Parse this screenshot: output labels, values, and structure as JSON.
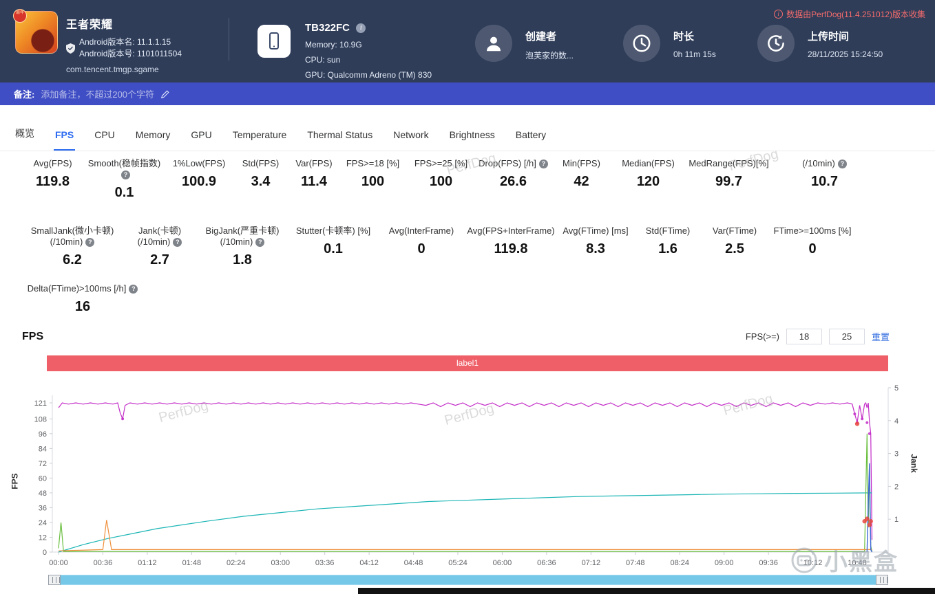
{
  "header": {
    "app": {
      "title": "王者荣耀",
      "badge": "周年",
      "version_name": "Android版本名: 11.1.1.15",
      "version_code": "Android版本号: 1101011504",
      "package": "com.tencent.tmgp.sgame"
    },
    "device": {
      "model": "TB322FC",
      "memory": "Memory: 10.9G",
      "cpu": "CPU: sun",
      "gpu": "GPU: Qualcomm Adreno (TM) 830"
    },
    "creator": {
      "label": "创建者",
      "value": "泡芙家的数..."
    },
    "duration": {
      "label": "时长",
      "value": "0h 11m 15s"
    },
    "upload_time": {
      "label": "上传时间",
      "value": "28/11/2025 15:24:50"
    },
    "version_note": "数据由PerfDog(11.4.251012)版本收集"
  },
  "note_bar": {
    "label": "备注:",
    "placeholder": "添加备注，不超过200个字符"
  },
  "tabs": [
    {
      "label": "概览",
      "active": false
    },
    {
      "label": "FPS",
      "active": true
    },
    {
      "label": "CPU",
      "active": false
    },
    {
      "label": "Memory",
      "active": false
    },
    {
      "label": "GPU",
      "active": false
    },
    {
      "label": "Temperature",
      "active": false
    },
    {
      "label": "Thermal Status",
      "active": false
    },
    {
      "label": "Network",
      "active": false
    },
    {
      "label": "Brightness",
      "active": false
    },
    {
      "label": "Battery",
      "active": false
    }
  ],
  "metrics": {
    "row1": [
      {
        "label": "Avg(FPS)",
        "value": "119.8",
        "help": false
      },
      {
        "label": "Smooth(稳帧指数)",
        "value": "0.1",
        "help": true
      },
      {
        "label": "1%Low(FPS)",
        "value": "100.9",
        "help": false
      },
      {
        "label": "Std(FPS)",
        "value": "3.4",
        "help": false
      },
      {
        "label": "Var(FPS)",
        "value": "11.4",
        "help": false
      },
      {
        "label": "FPS>=18 [%]",
        "value": "100",
        "help": false
      },
      {
        "label": "FPS>=25 [%]",
        "value": "100",
        "help": false
      },
      {
        "label": "Drop(FPS) [/h]",
        "value": "26.6",
        "help": true
      },
      {
        "label": "Min(FPS)",
        "value": "42",
        "help": false
      },
      {
        "label": "Median(FPS)",
        "value": "120",
        "help": false
      },
      {
        "label": "MedRange(FPS)[%]",
        "value": "99.7",
        "help": false
      },
      {
        "label": "(/10min)",
        "value": "10.7",
        "help": true
      }
    ],
    "row2": [
      {
        "label": "SmallJank(微小卡顿)",
        "label2": "(/10min)",
        "value": "6.2",
        "help": true
      },
      {
        "label": "Jank(卡顿)",
        "label2": "(/10min)",
        "value": "2.7",
        "help": true
      },
      {
        "label": "BigJank(严重卡顿)",
        "label2": "(/10min)",
        "value": "1.8",
        "help": true
      },
      {
        "label": "Stutter(卡顿率) [%]",
        "value": "0.1",
        "help": false
      },
      {
        "label": "Avg(InterFrame)",
        "value": "0",
        "help": false
      },
      {
        "label": "Avg(FPS+InterFrame)",
        "value": "119.8",
        "help": false
      },
      {
        "label": "Avg(FTime) [ms]",
        "value": "8.3",
        "help": false
      },
      {
        "label": "Std(FTime)",
        "value": "1.6",
        "help": false
      },
      {
        "label": "Var(FTime)",
        "value": "2.5",
        "help": false
      },
      {
        "label": "FTime>=100ms [%]",
        "value": "0",
        "help": false
      }
    ],
    "row3": [
      {
        "label": "Delta(FTime)>100ms [/h]",
        "value": "16",
        "help": true
      }
    ]
  },
  "fps_section": {
    "title": "FPS",
    "filter_label": "FPS(>=)",
    "input1": "18",
    "input2": "25",
    "reset_label": "重置",
    "banner_label": "label1",
    "banner_color": "#ef5f68"
  },
  "chart_data": {
    "type": "line",
    "title": "FPS",
    "grid": false,
    "y_left": {
      "label": "FPS",
      "ticks": [
        0,
        12,
        24,
        36,
        48,
        60,
        72,
        84,
        96,
        108,
        121
      ],
      "max": 121
    },
    "y_right": {
      "label": "Jank",
      "ticks": [
        0,
        1,
        2,
        3,
        4,
        5
      ],
      "max": 5
    },
    "x_ticks": [
      "00:00",
      "00:36",
      "01:12",
      "01:48",
      "02:24",
      "03:00",
      "03:36",
      "04:12",
      "04:48",
      "05:24",
      "06:00",
      "06:36",
      "07:12",
      "07:48",
      "08:24",
      "09:00",
      "09:36",
      "10:12",
      "10:48"
    ],
    "x_interval_seconds": 36,
    "series": [
      {
        "name": "fps",
        "color": "#c32cc8",
        "axis": "left",
        "width": 1.2,
        "points": [
          [
            0,
            117
          ],
          [
            3,
            121
          ],
          [
            8,
            120
          ],
          [
            14,
            121
          ],
          [
            20,
            120
          ],
          [
            26,
            121
          ],
          [
            32,
            120
          ],
          [
            38,
            121
          ],
          [
            44,
            120
          ],
          [
            48,
            121
          ],
          [
            50,
            113
          ],
          [
            52,
            108
          ],
          [
            54,
            119
          ],
          [
            58,
            121
          ],
          [
            64,
            120
          ],
          [
            70,
            121
          ],
          [
            76,
            120
          ],
          [
            82,
            121
          ],
          [
            88,
            120
          ],
          [
            94,
            121
          ],
          [
            100,
            120
          ],
          [
            106,
            121
          ],
          [
            112,
            120
          ],
          [
            118,
            121
          ],
          [
            124,
            120
          ],
          [
            130,
            121
          ],
          [
            136,
            120
          ],
          [
            142,
            121
          ],
          [
            148,
            120
          ],
          [
            154,
            121
          ],
          [
            160,
            120
          ],
          [
            166,
            121
          ],
          [
            172,
            120
          ],
          [
            178,
            121
          ],
          [
            184,
            120
          ],
          [
            190,
            121
          ],
          [
            196,
            120
          ],
          [
            202,
            121
          ],
          [
            208,
            120
          ],
          [
            214,
            121
          ],
          [
            220,
            120
          ],
          [
            226,
            121
          ],
          [
            232,
            120
          ],
          [
            238,
            121
          ],
          [
            244,
            120
          ],
          [
            250,
            121
          ],
          [
            256,
            120
          ],
          [
            262,
            121
          ],
          [
            268,
            120
          ],
          [
            274,
            121
          ],
          [
            280,
            120
          ],
          [
            286,
            121
          ],
          [
            292,
            120
          ],
          [
            298,
            119
          ],
          [
            304,
            121
          ],
          [
            310,
            118
          ],
          [
            316,
            121
          ],
          [
            322,
            119
          ],
          [
            328,
            121
          ],
          [
            334,
            118
          ],
          [
            340,
            121
          ],
          [
            346,
            119
          ],
          [
            352,
            121
          ],
          [
            358,
            118
          ],
          [
            364,
            121
          ],
          [
            370,
            119
          ],
          [
            376,
            121
          ],
          [
            382,
            118
          ],
          [
            388,
            121
          ],
          [
            394,
            119
          ],
          [
            400,
            121
          ],
          [
            406,
            118
          ],
          [
            412,
            121
          ],
          [
            418,
            119
          ],
          [
            424,
            121
          ],
          [
            430,
            118
          ],
          [
            436,
            121
          ],
          [
            442,
            119
          ],
          [
            448,
            121
          ],
          [
            454,
            118
          ],
          [
            460,
            121
          ],
          [
            466,
            119
          ],
          [
            472,
            121
          ],
          [
            478,
            118
          ],
          [
            484,
            121
          ],
          [
            490,
            119
          ],
          [
            496,
            121
          ],
          [
            502,
            118
          ],
          [
            508,
            121
          ],
          [
            514,
            119
          ],
          [
            520,
            121
          ],
          [
            526,
            118
          ],
          [
            532,
            121
          ],
          [
            538,
            119
          ],
          [
            544,
            121
          ],
          [
            550,
            118
          ],
          [
            556,
            121
          ],
          [
            562,
            119
          ],
          [
            568,
            121
          ],
          [
            574,
            118
          ],
          [
            580,
            121
          ],
          [
            586,
            119
          ],
          [
            592,
            121
          ],
          [
            598,
            118
          ],
          [
            604,
            121
          ],
          [
            610,
            119
          ],
          [
            616,
            121
          ],
          [
            622,
            120
          ],
          [
            628,
            121
          ],
          [
            634,
            120
          ],
          [
            640,
            121
          ],
          [
            644,
            120
          ],
          [
            646,
            112
          ],
          [
            648,
            105
          ],
          [
            650,
            119
          ],
          [
            652,
            108
          ],
          [
            654,
            120
          ],
          [
            655,
            121
          ],
          [
            656,
            117
          ],
          [
            657,
            121
          ],
          [
            658,
            105
          ],
          [
            659,
            96
          ],
          [
            660,
            10
          ]
        ]
      },
      {
        "name": "fps-dip-markers",
        "color": "#c32cc8",
        "axis": "left",
        "r": 2,
        "dots": [
          [
            52,
            108
          ],
          [
            646,
            112
          ],
          [
            648,
            105
          ],
          [
            652,
            108
          ],
          [
            656,
            105
          ],
          [
            658,
            96
          ]
        ]
      },
      {
        "name": "cumulative-curve",
        "color": "#1cb5b5",
        "axis": "left",
        "width": 1.2,
        "points": [
          [
            0,
            0
          ],
          [
            20,
            6
          ],
          [
            40,
            11
          ],
          [
            60,
            15
          ],
          [
            80,
            19
          ],
          [
            100,
            22
          ],
          [
            120,
            25
          ],
          [
            150,
            29
          ],
          [
            180,
            32
          ],
          [
            210,
            35
          ],
          [
            240,
            37
          ],
          [
            270,
            39
          ],
          [
            300,
            41
          ],
          [
            330,
            42
          ],
          [
            360,
            43
          ],
          [
            390,
            44
          ],
          [
            420,
            45
          ],
          [
            450,
            45.5
          ],
          [
            480,
            46
          ],
          [
            510,
            46.5
          ],
          [
            540,
            47
          ],
          [
            570,
            47.3
          ],
          [
            600,
            47.6
          ],
          [
            630,
            47.8
          ],
          [
            660,
            48
          ]
        ]
      },
      {
        "name": "jank-spikes-green",
        "color": "#6abf3f",
        "axis": "left",
        "width": 1.2,
        "points": [
          [
            0,
            3
          ],
          [
            2,
            24
          ],
          [
            4,
            0.5
          ],
          [
            300,
            0.5
          ],
          [
            648,
            0.5
          ],
          [
            654,
            0.5
          ],
          [
            656,
            96
          ],
          [
            657,
            20
          ],
          [
            658,
            70
          ],
          [
            659,
            5
          ],
          [
            660,
            0.5
          ]
        ]
      },
      {
        "name": "stutter-spike-orange",
        "color": "#ef8f3c",
        "axis": "left",
        "width": 1.2,
        "points": [
          [
            0,
            1
          ],
          [
            36,
            2
          ],
          [
            39,
            26
          ],
          [
            43,
            2
          ],
          [
            300,
            2
          ],
          [
            660,
            2
          ]
        ]
      },
      {
        "name": "end-spike-blue",
        "color": "#4169d8",
        "axis": "left",
        "width": 1.4,
        "points": [
          [
            656,
            0
          ],
          [
            657,
            40
          ],
          [
            658,
            72
          ],
          [
            659,
            2
          ],
          [
            660,
            0
          ]
        ]
      },
      {
        "name": "bigjank-markers-red",
        "color": "#e8453c",
        "axis": "left",
        "r": 3.2,
        "dots": [
          [
            648,
            104
          ],
          [
            654,
            25
          ],
          [
            656,
            27
          ],
          [
            658,
            22
          ],
          [
            659,
            25
          ]
        ]
      }
    ]
  },
  "watermark": {
    "tile": "PerfDog",
    "brand": "小黑盒"
  }
}
